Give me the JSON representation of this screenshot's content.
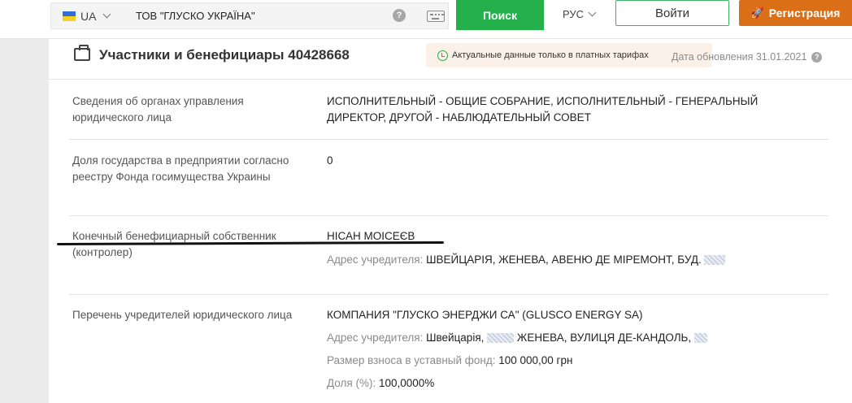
{
  "header": {
    "lang_region": "UA",
    "search_query": "ТОВ \"ГЛУСКО УКРАЇНА\"",
    "search_button": "Поиск",
    "ui_language": "РУС",
    "login_button": "Войти",
    "register_button": "Регистрация",
    "help_glyph": "?"
  },
  "card": {
    "title": "Участники и бенефициары 40428668",
    "notice": "Актуальные данные только в платных тарифах",
    "update_date": "Дата обновления 31.01.2021",
    "rows": [
      {
        "label": "Сведения об органах управления юридического лица",
        "value": "ИСПОЛНИТЕЛЬНЫЙ - ОБЩИЕ СОБРАНИЕ, ИСПОЛНИТЕЛЬНЫЙ - ГЕНЕРАЛЬНЫЙ ДИРЕКТОР, ДРУГОЙ - НАБЛЮДАТЕЛЬНЫЙ СОВЕТ"
      },
      {
        "label": "Доля государства в предприятии согласно реестру Фонда госимущества Украины",
        "value": "0"
      },
      {
        "label": "Конечный бенефициарный собственник (контролер)",
        "value": "НІСАН МОІСЕЄВ",
        "address_key": "Адрес учредителя:",
        "address_value": "ШВЕЙЦАРІЯ, ЖЕНЕВА, АВЕНЮ ДЕ МІРЕМОНТ, БУД."
      },
      {
        "label": "Перечень учредителей юридического лица",
        "value": "КОМПАНИЯ \"ГЛУСКО ЭНЕРДЖИ СА\" (GLUSCO ENERGY SA)",
        "address_key": "Адрес учредителя:",
        "address_part1": "Швейцарія,",
        "address_part2": "ЖЕНЕВА, ВУЛИЦЯ ДЕ-КАНДОЛЬ,",
        "contribution_key": "Размер взноса в уставный фонд:",
        "contribution_value": "100 000,00 грн",
        "share_key": "Доля (%):",
        "share_value": "100,0000%"
      }
    ]
  },
  "colors": {
    "search_green": "#24b14c",
    "register_orange": "#db6f17",
    "notice_bg": "#fbf1e8"
  },
  "icons": [
    "flag-ua-icon",
    "chevron-down-icon",
    "help-icon",
    "keyboard-icon",
    "rocket-icon",
    "briefcase-icon",
    "clock-icon"
  ]
}
